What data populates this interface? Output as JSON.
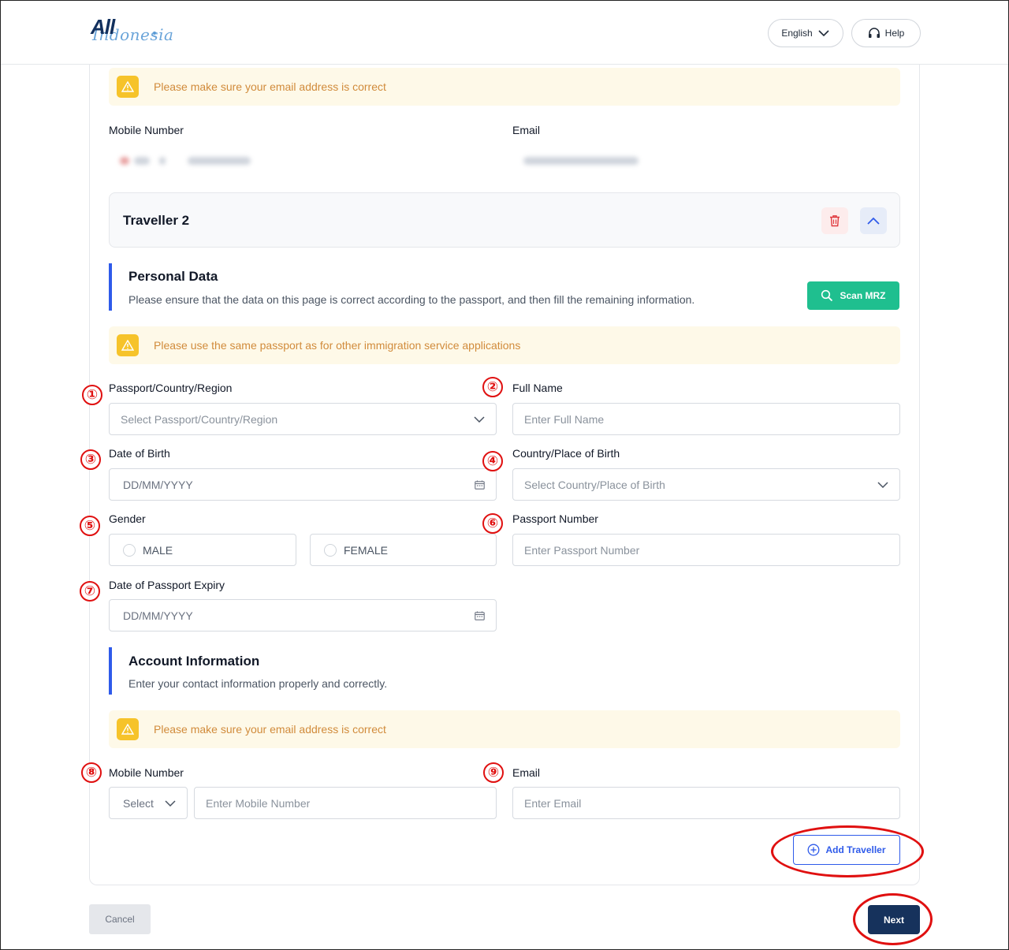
{
  "header": {
    "logo_primary": "All",
    "logo_secondary": "Indonesia",
    "language": "English",
    "help": "Help"
  },
  "email_warning_top": "Please make sure your email address is correct",
  "traveller1_contact": {
    "mobile_label": "Mobile Number",
    "email_label": "Email"
  },
  "traveller2": {
    "title": "Traveller 2",
    "personal": {
      "title": "Personal Data",
      "description": "Please ensure that the data on this page is correct according to the passport, and then fill the remaining information.",
      "scan_button": "Scan MRZ",
      "warning": "Please use the same passport as for other immigration service applications"
    },
    "fields": {
      "passport_country_label": "Passport/Country/Region",
      "passport_country_placeholder": "Select Passport/Country/Region",
      "full_name_label": "Full Name",
      "full_name_placeholder": "Enter Full Name",
      "dob_label": "Date of Birth",
      "dob_placeholder": "DD/MM/YYYY",
      "birth_place_label": "Country/Place of Birth",
      "birth_place_placeholder": "Select Country/Place of Birth",
      "gender_label": "Gender",
      "gender_male": "MALE",
      "gender_female": "FEMALE",
      "passport_number_label": "Passport Number",
      "passport_number_placeholder": "Enter Passport Number",
      "expiry_label": "Date of Passport Expiry",
      "expiry_placeholder": "DD/MM/YYYY"
    },
    "account": {
      "title": "Account Information",
      "description": "Enter your contact information properly and correctly.",
      "warning": "Please make sure your email address is correct",
      "mobile_label": "Mobile Number",
      "code_select": "Select",
      "mobile_placeholder": "Enter Mobile Number",
      "email_label": "Email",
      "email_placeholder": "Enter Email"
    }
  },
  "add_traveller": "Add Traveller",
  "cancel": "Cancel",
  "next": "Next",
  "annotations": [
    "①",
    "②",
    "③",
    "④",
    "⑤",
    "⑥",
    "⑦",
    "⑧",
    "⑨"
  ],
  "colors": {
    "accent_blue": "#2f5bea",
    "navy": "#16325c",
    "scan_green": "#1fbf8f",
    "warning_bg": "#fef9e8",
    "warning_text": "#d18b3b",
    "annotation_red": "#e01010"
  }
}
